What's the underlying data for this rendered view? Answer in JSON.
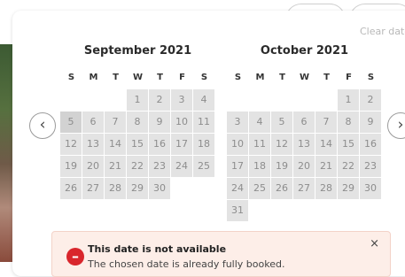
{
  "toolbar": {
    "clear_dates": "Clear dates"
  },
  "calendar": {
    "weekdays": [
      "S",
      "M",
      "T",
      "W",
      "T",
      "F",
      "S"
    ],
    "months": [
      {
        "title": "September 2021",
        "weeks": [
          [
            "",
            "",
            "",
            "1",
            "2",
            "3",
            "4"
          ],
          [
            "5",
            "6",
            "7",
            "8",
            "9",
            "10",
            "11"
          ],
          [
            "12",
            "13",
            "14",
            "15",
            "16",
            "17",
            "18"
          ],
          [
            "19",
            "20",
            "21",
            "22",
            "23",
            "24",
            "25"
          ],
          [
            "26",
            "27",
            "28",
            "29",
            "30",
            "",
            ""
          ]
        ],
        "selected_day": "5"
      },
      {
        "title": "October 2021",
        "weeks": [
          [
            "",
            "",
            "",
            "",
            "",
            "1",
            "2"
          ],
          [
            "3",
            "4",
            "5",
            "6",
            "7",
            "8",
            "9"
          ],
          [
            "10",
            "11",
            "12",
            "13",
            "14",
            "15",
            "16"
          ],
          [
            "17",
            "18",
            "19",
            "20",
            "21",
            "22",
            "23"
          ],
          [
            "24",
            "25",
            "26",
            "27",
            "28",
            "29",
            "30"
          ],
          [
            "31",
            "",
            "",
            "",
            "",
            "",
            ""
          ]
        ]
      }
    ],
    "prev_icon": "‹",
    "next_icon": "›"
  },
  "alert": {
    "title": "This date is not available",
    "message": "The chosen date is already fully booked.",
    "close": "×",
    "icon": "–"
  }
}
